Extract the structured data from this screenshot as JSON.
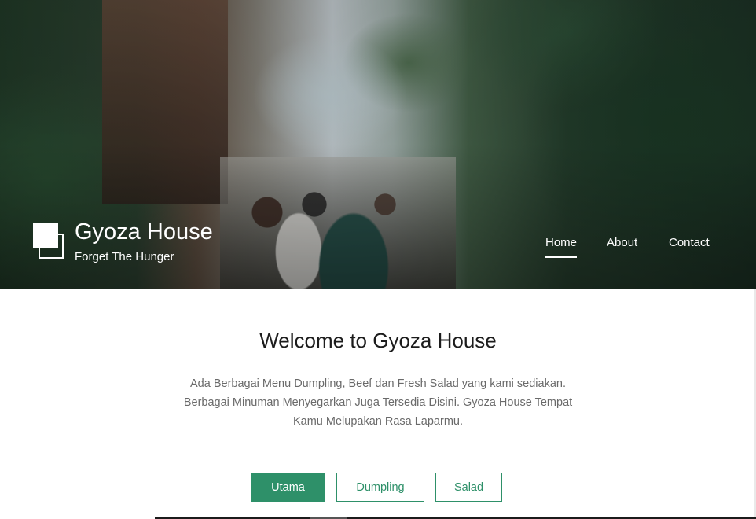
{
  "brand": {
    "title": "Gyoza House",
    "tagline": "Forget The Hunger",
    "logo_icon": "overlapping-squares-icon"
  },
  "nav": {
    "items": [
      {
        "label": "Home",
        "active": true
      },
      {
        "label": "About",
        "active": false
      },
      {
        "label": "Contact",
        "active": false
      }
    ]
  },
  "main": {
    "heading": "Welcome to Gyoza House",
    "intro_lines": [
      "Ada Berbagai Menu Dumpling, Beef dan Fresh Salad yang kami sediakan.",
      "Berbagai Minuman Menyegarkan Juga Tersedia Disini. Gyoza House Tempat",
      "Kamu Melupakan Rasa Laparmu."
    ]
  },
  "filters": {
    "items": [
      {
        "label": "Utama",
        "active": true
      },
      {
        "label": "Dumpling",
        "active": false
      },
      {
        "label": "Salad",
        "active": false
      }
    ]
  },
  "colors": {
    "accent": "#2e9069",
    "text_dark": "#1c1c1c",
    "text_muted": "#6a6a6a"
  }
}
